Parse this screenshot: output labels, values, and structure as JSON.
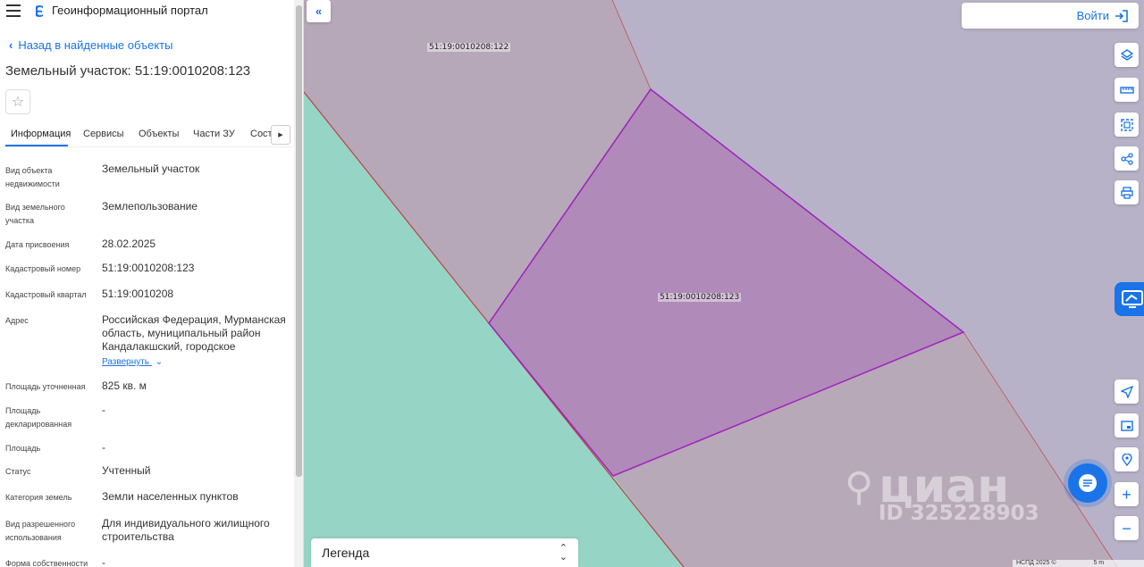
{
  "header": {
    "app_title": "Геоинформационный портал"
  },
  "nav": {
    "back_label": "Назад в найденные объекты"
  },
  "object": {
    "title": "Земельный участок: 51:19:0010208:123"
  },
  "tabs": [
    {
      "label": "Информация"
    },
    {
      "label": "Сервисы"
    },
    {
      "label": "Объекты"
    },
    {
      "label": "Части ЗУ"
    },
    {
      "label": "Соста"
    }
  ],
  "properties": [
    {
      "label": "Вид объекта недвижимости",
      "value": "Земельный участок"
    },
    {
      "label": "Вид земельного участка",
      "value": "Землепользование"
    },
    {
      "label": "Дата присвоения",
      "value": "28.02.2025"
    },
    {
      "label": "Кадастровый номер",
      "value": "51:19:0010208:123"
    },
    {
      "label": "Кадастровый квартал",
      "value": "51:19:0010208"
    },
    {
      "label": "Адрес",
      "value": "Российская Федерация, Мурманская область, муниципальный район Кандалакшский, городское"
    },
    {
      "label": "Площадь уточненная",
      "value": "825 кв. м"
    },
    {
      "label": "Площадь декларированная",
      "value": "-"
    },
    {
      "label": "Площадь",
      "value": "-"
    },
    {
      "label": "Статус",
      "value": "Учтенный"
    },
    {
      "label": "Категория земель",
      "value": "Земли населенных пунктов"
    },
    {
      "label": "Вид разрешенного использования",
      "value": "Для индивидуального жилищного строительства"
    },
    {
      "label": "Форма собственности",
      "value": "-"
    }
  ],
  "address_expand_label": "Развернуть",
  "map": {
    "parcel_labels": [
      "51:19:0010208:122",
      "51:19:0010208:123"
    ],
    "login_label": "Войти",
    "legend_label": "Легенда",
    "watermark_brand": "циан",
    "watermark_id": "ID 325228903",
    "attribution": "НСПД 2025 ©",
    "scale_label": "5 m"
  },
  "colors": {
    "accent": "#1a73e8",
    "selected_parcel_fill": "#b08ab8",
    "selected_parcel_stroke": "#a020c0",
    "green_zone": "#96d5c5",
    "background_parcel": "#b8b2c8"
  }
}
